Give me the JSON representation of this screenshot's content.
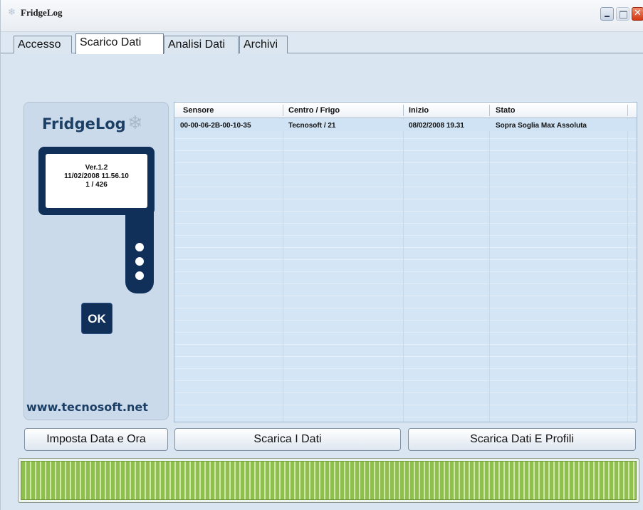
{
  "window": {
    "title": "FridgeLog"
  },
  "tabs": [
    {
      "label": "Accesso",
      "active": false
    },
    {
      "label": "Scarico Dati",
      "active": true
    },
    {
      "label": "Analisi Dati",
      "active": false
    },
    {
      "label": "Archivi",
      "active": false
    }
  ],
  "device": {
    "logo": "FridgeLog",
    "screen_line1": "Ver.1.2",
    "screen_line2": "11/02/2008 11.56.10",
    "screen_line3": "1 / 426",
    "ok_label": "OK",
    "url": "www.tecnosoft.net"
  },
  "table": {
    "columns": [
      "Sensore",
      "Centro / Frigo",
      "Inizio",
      "Stato"
    ],
    "rows": [
      [
        "00-00-06-2B-00-10-35",
        "Tecnosoft / 21",
        "08/02/2008 19.31",
        "Sopra Soglia Max Assoluta"
      ]
    ]
  },
  "buttons": {
    "set_datetime": "Imposta Data e Ora",
    "download": "Scarica I Dati",
    "download_profiles": "Scarica Dati E Profili"
  },
  "progress": {
    "fraction": 1.0
  },
  "colors": {
    "accent": "#10305a",
    "progress": "#8fbf4e",
    "close": "#d23a14"
  }
}
